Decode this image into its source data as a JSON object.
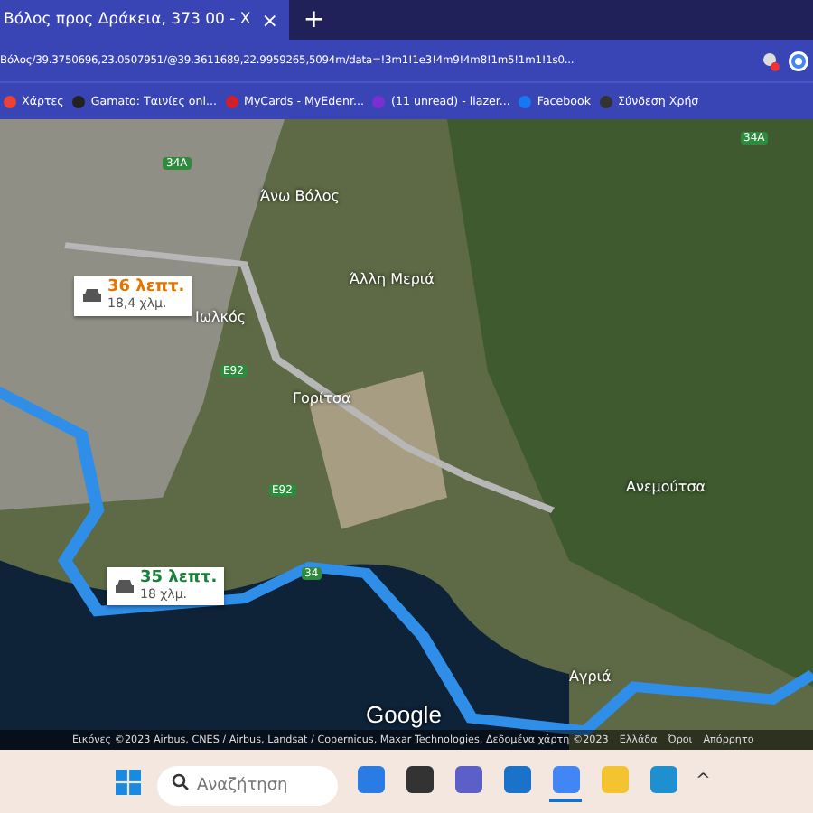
{
  "tabs": [
    {
      "title": "Βόλος προς Δράκεια, 373 00 - X",
      "selected": true,
      "close": "×"
    }
  ],
  "new_tab": "+",
  "address": "Βόλος/39.3750696,23.0507951/@39.3611689,22.9959265,5094m/data=!3m1!1e3!4m9!4m8!1m5!1m1!1s0...",
  "bookmarks": [
    {
      "label": "Χάρτες",
      "kind": "pin"
    },
    {
      "label": "Gamato: Ταινίες onl...",
      "kind": "g"
    },
    {
      "label": "MyCards - MyEdenr...",
      "kind": "card"
    },
    {
      "label": "(11 unread) - liazer...",
      "kind": "mail"
    },
    {
      "label": "Facebook",
      "kind": "fb"
    },
    {
      "label": "Σύνδεση Χρήσ",
      "kind": "globe"
    }
  ],
  "map": {
    "places": [
      "Άνω Βόλος",
      "Άλλη Μεριά",
      "Ιωλκός",
      "Γορίτσα",
      "Ανεμούτσα",
      "Αγριά"
    ],
    "shields": [
      "34A",
      "34A",
      "E92",
      "E92",
      "34"
    ],
    "routes": [
      {
        "duration": "36 λεπτ.",
        "distance": "18,4 χλμ.",
        "selected": false
      },
      {
        "duration": "35 λεπτ.",
        "distance": "18 χλμ.",
        "selected": true
      }
    ],
    "logo": "Google",
    "attribution": "Εικόνες ©2023 Airbus, CNES / Airbus, Landsat / Copernicus, Maxar Technologies, Δεδομένα χάρτη ©2023",
    "links": [
      "Ελλάδα",
      "Όροι",
      "Απόρρητο"
    ]
  },
  "taskbar": {
    "search_placeholder": "Αναζήτηση",
    "apps": [
      {
        "kind": "bing",
        "active": false
      },
      {
        "kind": "tiles",
        "active": false
      },
      {
        "kind": "video",
        "active": false
      },
      {
        "kind": "mail",
        "active": false
      },
      {
        "kind": "chrome",
        "active": true
      },
      {
        "kind": "folder",
        "active": false
      },
      {
        "kind": "store",
        "active": false
      }
    ],
    "tray": "^"
  }
}
